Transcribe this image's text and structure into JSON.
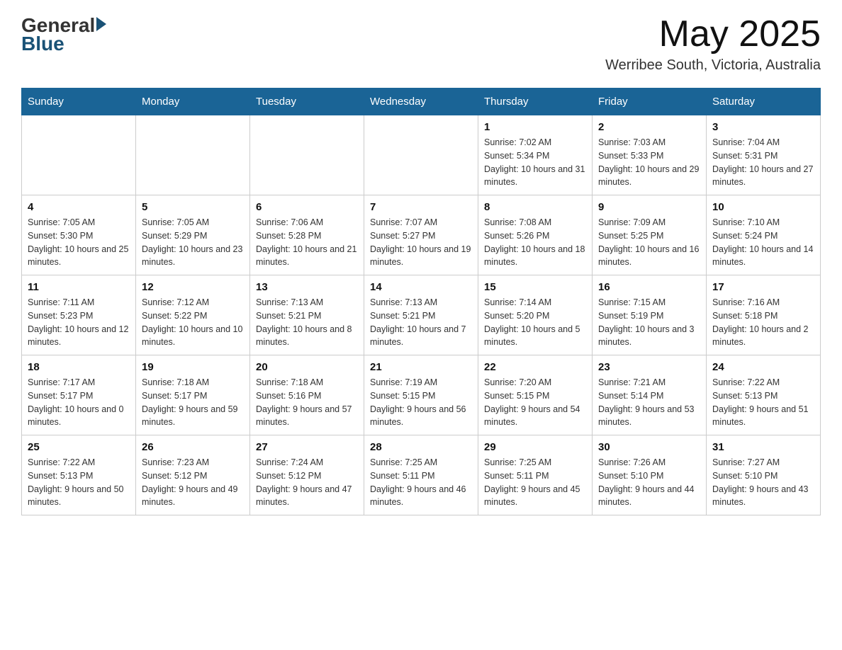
{
  "header": {
    "logo_general": "General",
    "logo_blue": "Blue",
    "month_year": "May 2025",
    "location": "Werribee South, Victoria, Australia"
  },
  "days_of_week": [
    "Sunday",
    "Monday",
    "Tuesday",
    "Wednesday",
    "Thursday",
    "Friday",
    "Saturday"
  ],
  "weeks": [
    [
      {
        "day": "",
        "sunrise": "",
        "sunset": "",
        "daylight": ""
      },
      {
        "day": "",
        "sunrise": "",
        "sunset": "",
        "daylight": ""
      },
      {
        "day": "",
        "sunrise": "",
        "sunset": "",
        "daylight": ""
      },
      {
        "day": "",
        "sunrise": "",
        "sunset": "",
        "daylight": ""
      },
      {
        "day": "1",
        "sunrise": "Sunrise: 7:02 AM",
        "sunset": "Sunset: 5:34 PM",
        "daylight": "Daylight: 10 hours and 31 minutes."
      },
      {
        "day": "2",
        "sunrise": "Sunrise: 7:03 AM",
        "sunset": "Sunset: 5:33 PM",
        "daylight": "Daylight: 10 hours and 29 minutes."
      },
      {
        "day": "3",
        "sunrise": "Sunrise: 7:04 AM",
        "sunset": "Sunset: 5:31 PM",
        "daylight": "Daylight: 10 hours and 27 minutes."
      }
    ],
    [
      {
        "day": "4",
        "sunrise": "Sunrise: 7:05 AM",
        "sunset": "Sunset: 5:30 PM",
        "daylight": "Daylight: 10 hours and 25 minutes."
      },
      {
        "day": "5",
        "sunrise": "Sunrise: 7:05 AM",
        "sunset": "Sunset: 5:29 PM",
        "daylight": "Daylight: 10 hours and 23 minutes."
      },
      {
        "day": "6",
        "sunrise": "Sunrise: 7:06 AM",
        "sunset": "Sunset: 5:28 PM",
        "daylight": "Daylight: 10 hours and 21 minutes."
      },
      {
        "day": "7",
        "sunrise": "Sunrise: 7:07 AM",
        "sunset": "Sunset: 5:27 PM",
        "daylight": "Daylight: 10 hours and 19 minutes."
      },
      {
        "day": "8",
        "sunrise": "Sunrise: 7:08 AM",
        "sunset": "Sunset: 5:26 PM",
        "daylight": "Daylight: 10 hours and 18 minutes."
      },
      {
        "day": "9",
        "sunrise": "Sunrise: 7:09 AM",
        "sunset": "Sunset: 5:25 PM",
        "daylight": "Daylight: 10 hours and 16 minutes."
      },
      {
        "day": "10",
        "sunrise": "Sunrise: 7:10 AM",
        "sunset": "Sunset: 5:24 PM",
        "daylight": "Daylight: 10 hours and 14 minutes."
      }
    ],
    [
      {
        "day": "11",
        "sunrise": "Sunrise: 7:11 AM",
        "sunset": "Sunset: 5:23 PM",
        "daylight": "Daylight: 10 hours and 12 minutes."
      },
      {
        "day": "12",
        "sunrise": "Sunrise: 7:12 AM",
        "sunset": "Sunset: 5:22 PM",
        "daylight": "Daylight: 10 hours and 10 minutes."
      },
      {
        "day": "13",
        "sunrise": "Sunrise: 7:13 AM",
        "sunset": "Sunset: 5:21 PM",
        "daylight": "Daylight: 10 hours and 8 minutes."
      },
      {
        "day": "14",
        "sunrise": "Sunrise: 7:13 AM",
        "sunset": "Sunset: 5:21 PM",
        "daylight": "Daylight: 10 hours and 7 minutes."
      },
      {
        "day": "15",
        "sunrise": "Sunrise: 7:14 AM",
        "sunset": "Sunset: 5:20 PM",
        "daylight": "Daylight: 10 hours and 5 minutes."
      },
      {
        "day": "16",
        "sunrise": "Sunrise: 7:15 AM",
        "sunset": "Sunset: 5:19 PM",
        "daylight": "Daylight: 10 hours and 3 minutes."
      },
      {
        "day": "17",
        "sunrise": "Sunrise: 7:16 AM",
        "sunset": "Sunset: 5:18 PM",
        "daylight": "Daylight: 10 hours and 2 minutes."
      }
    ],
    [
      {
        "day": "18",
        "sunrise": "Sunrise: 7:17 AM",
        "sunset": "Sunset: 5:17 PM",
        "daylight": "Daylight: 10 hours and 0 minutes."
      },
      {
        "day": "19",
        "sunrise": "Sunrise: 7:18 AM",
        "sunset": "Sunset: 5:17 PM",
        "daylight": "Daylight: 9 hours and 59 minutes."
      },
      {
        "day": "20",
        "sunrise": "Sunrise: 7:18 AM",
        "sunset": "Sunset: 5:16 PM",
        "daylight": "Daylight: 9 hours and 57 minutes."
      },
      {
        "day": "21",
        "sunrise": "Sunrise: 7:19 AM",
        "sunset": "Sunset: 5:15 PM",
        "daylight": "Daylight: 9 hours and 56 minutes."
      },
      {
        "day": "22",
        "sunrise": "Sunrise: 7:20 AM",
        "sunset": "Sunset: 5:15 PM",
        "daylight": "Daylight: 9 hours and 54 minutes."
      },
      {
        "day": "23",
        "sunrise": "Sunrise: 7:21 AM",
        "sunset": "Sunset: 5:14 PM",
        "daylight": "Daylight: 9 hours and 53 minutes."
      },
      {
        "day": "24",
        "sunrise": "Sunrise: 7:22 AM",
        "sunset": "Sunset: 5:13 PM",
        "daylight": "Daylight: 9 hours and 51 minutes."
      }
    ],
    [
      {
        "day": "25",
        "sunrise": "Sunrise: 7:22 AM",
        "sunset": "Sunset: 5:13 PM",
        "daylight": "Daylight: 9 hours and 50 minutes."
      },
      {
        "day": "26",
        "sunrise": "Sunrise: 7:23 AM",
        "sunset": "Sunset: 5:12 PM",
        "daylight": "Daylight: 9 hours and 49 minutes."
      },
      {
        "day": "27",
        "sunrise": "Sunrise: 7:24 AM",
        "sunset": "Sunset: 5:12 PM",
        "daylight": "Daylight: 9 hours and 47 minutes."
      },
      {
        "day": "28",
        "sunrise": "Sunrise: 7:25 AM",
        "sunset": "Sunset: 5:11 PM",
        "daylight": "Daylight: 9 hours and 46 minutes."
      },
      {
        "day": "29",
        "sunrise": "Sunrise: 7:25 AM",
        "sunset": "Sunset: 5:11 PM",
        "daylight": "Daylight: 9 hours and 45 minutes."
      },
      {
        "day": "30",
        "sunrise": "Sunrise: 7:26 AM",
        "sunset": "Sunset: 5:10 PM",
        "daylight": "Daylight: 9 hours and 44 minutes."
      },
      {
        "day": "31",
        "sunrise": "Sunrise: 7:27 AM",
        "sunset": "Sunset: 5:10 PM",
        "daylight": "Daylight: 9 hours and 43 minutes."
      }
    ]
  ]
}
